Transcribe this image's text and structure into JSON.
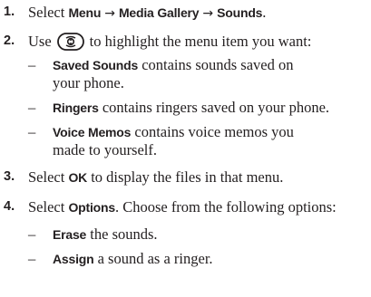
{
  "steps": [
    {
      "number": "1.",
      "text": "Select",
      "path": [
        "Menu",
        "Media Gallery",
        "Sounds"
      ],
      "arrow": "→",
      "end": "."
    },
    {
      "number": "2.",
      "before": "Use",
      "icon": "navigation-key-icon",
      "after": "to highlight the menu item you want:",
      "items": [
        {
          "term": "Saved Sounds",
          "line1": "contains sounds saved on",
          "line2": "your phone."
        },
        {
          "term": "Ringers",
          "line1": "contains ringers saved on your phone."
        },
        {
          "term": "Voice Memos",
          "line1": "contains voice memos you",
          "line2": "made to yourself."
        }
      ]
    },
    {
      "number": "3.",
      "before": "Select",
      "term": "OK",
      "after": "to display the files in that menu."
    },
    {
      "number": "4.",
      "before": "Select",
      "term": "Options",
      "after": ". Choose from the following options:",
      "items": [
        {
          "term": "Erase",
          "line1": "the sounds."
        },
        {
          "term": "Assign",
          "line1": "a sound as a ringer."
        }
      ]
    }
  ],
  "dash": "–",
  "colors": {
    "text": "#231f20"
  }
}
